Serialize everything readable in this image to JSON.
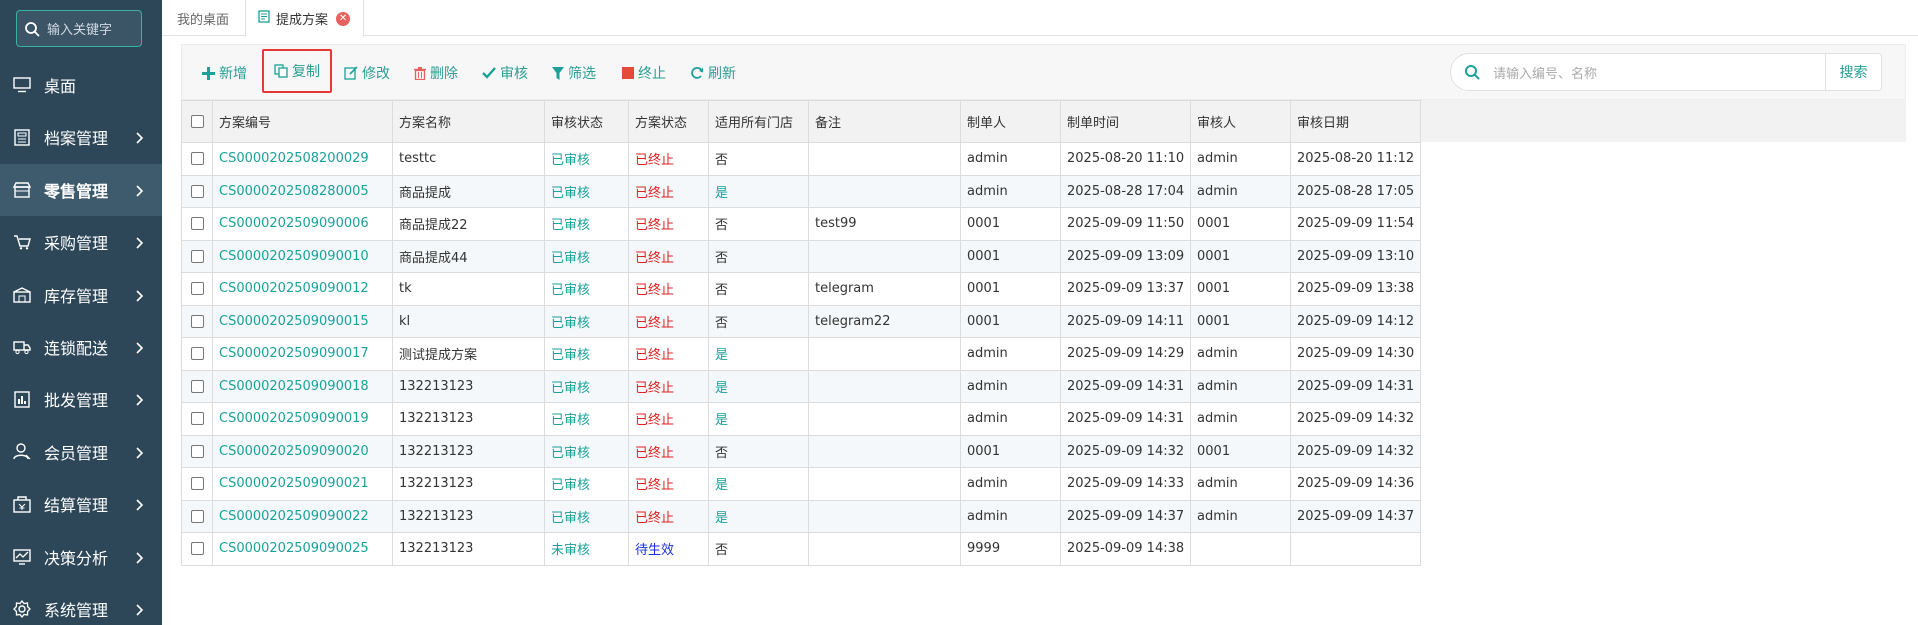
{
  "sidebar": {
    "search_placeholder": "输入关键字",
    "items": [
      {
        "label": "桌面",
        "icon": "desktop-icon",
        "has_children": false,
        "active": false
      },
      {
        "label": "档案管理",
        "icon": "archive-icon",
        "has_children": true,
        "active": false
      },
      {
        "label": "零售管理",
        "icon": "store-icon",
        "has_children": true,
        "active": true
      },
      {
        "label": "采购管理",
        "icon": "purchase-icon",
        "has_children": true,
        "active": false
      },
      {
        "label": "库存管理",
        "icon": "inventory-icon",
        "has_children": true,
        "active": false
      },
      {
        "label": "连锁配送",
        "icon": "truck-icon",
        "has_children": true,
        "active": false
      },
      {
        "label": "批发管理",
        "icon": "wholesale-icon",
        "has_children": true,
        "active": false
      },
      {
        "label": "会员管理",
        "icon": "member-icon",
        "has_children": true,
        "active": false
      },
      {
        "label": "结算管理",
        "icon": "settlement-icon",
        "has_children": true,
        "active": false
      },
      {
        "label": "决策分析",
        "icon": "analysis-icon",
        "has_children": true,
        "active": false
      },
      {
        "label": "系统管理",
        "icon": "gear-icon",
        "has_children": true,
        "active": false
      }
    ]
  },
  "tabs": {
    "home": "我的桌面",
    "current": "提成方案"
  },
  "toolbar": {
    "add": "新增",
    "copy": "复制",
    "edit": "修改",
    "delete": "删除",
    "audit": "审核",
    "filter": "筛选",
    "stop": "终止",
    "refresh": "刷新",
    "search_placeholder": "请输入编号、名称",
    "search_button": "搜索"
  },
  "table": {
    "headers": [
      "方案编号",
      "方案名称",
      "审核状态",
      "方案状态",
      "适用所有门店",
      "备注",
      "制单人",
      "制单时间",
      "审核人",
      "审核日期"
    ],
    "rows": [
      {
        "code": "CS0000202508200029",
        "name": "testtc",
        "audit": "已审核",
        "status": "已终止",
        "all_stores": "否",
        "remark": "",
        "creator": "admin",
        "created": "2025-08-20 11:10",
        "auditor": "admin",
        "audit_date": "2025-08-20 11:12"
      },
      {
        "code": "CS0000202508280005",
        "name": "商品提成",
        "audit": "已审核",
        "status": "已终止",
        "all_stores": "是",
        "remark": "",
        "creator": "admin",
        "created": "2025-08-28 17:04",
        "auditor": "admin",
        "audit_date": "2025-08-28 17:05"
      },
      {
        "code": "CS0000202509090006",
        "name": "商品提成22",
        "audit": "已审核",
        "status": "已终止",
        "all_stores": "否",
        "remark": "test99",
        "creator": "0001",
        "created": "2025-09-09 11:50",
        "auditor": "0001",
        "audit_date": "2025-09-09 11:54"
      },
      {
        "code": "CS0000202509090010",
        "name": "商品提成44",
        "audit": "已审核",
        "status": "已终止",
        "all_stores": "否",
        "remark": "",
        "creator": "0001",
        "created": "2025-09-09 13:09",
        "auditor": "0001",
        "audit_date": "2025-09-09 13:10"
      },
      {
        "code": "CS0000202509090012",
        "name": "tk",
        "audit": "已审核",
        "status": "已终止",
        "all_stores": "否",
        "remark": "telegram",
        "creator": "0001",
        "created": "2025-09-09 13:37",
        "auditor": "0001",
        "audit_date": "2025-09-09 13:38"
      },
      {
        "code": "CS0000202509090015",
        "name": "kl",
        "audit": "已审核",
        "status": "已终止",
        "all_stores": "否",
        "remark": "telegram22",
        "creator": "0001",
        "created": "2025-09-09 14:11",
        "auditor": "0001",
        "audit_date": "2025-09-09 14:12"
      },
      {
        "code": "CS0000202509090017",
        "name": "测试提成方案",
        "audit": "已审核",
        "status": "已终止",
        "all_stores": "是",
        "remark": "",
        "creator": "admin",
        "created": "2025-09-09 14:29",
        "auditor": "admin",
        "audit_date": "2025-09-09 14:30"
      },
      {
        "code": "CS0000202509090018",
        "name": "132213123",
        "audit": "已审核",
        "status": "已终止",
        "all_stores": "是",
        "remark": "",
        "creator": "admin",
        "created": "2025-09-09 14:31",
        "auditor": "admin",
        "audit_date": "2025-09-09 14:31"
      },
      {
        "code": "CS0000202509090019",
        "name": "132213123",
        "audit": "已审核",
        "status": "已终止",
        "all_stores": "是",
        "remark": "",
        "creator": "admin",
        "created": "2025-09-09 14:31",
        "auditor": "admin",
        "audit_date": "2025-09-09 14:32"
      },
      {
        "code": "CS0000202509090020",
        "name": "132213123",
        "audit": "已审核",
        "status": "已终止",
        "all_stores": "否",
        "remark": "",
        "creator": "0001",
        "created": "2025-09-09 14:32",
        "auditor": "0001",
        "audit_date": "2025-09-09 14:32"
      },
      {
        "code": "CS0000202509090021",
        "name": "132213123",
        "audit": "已审核",
        "status": "已终止",
        "all_stores": "是",
        "remark": "",
        "creator": "admin",
        "created": "2025-09-09 14:33",
        "auditor": "admin",
        "audit_date": "2025-09-09 14:36"
      },
      {
        "code": "CS0000202509090022",
        "name": "132213123",
        "audit": "已审核",
        "status": "已终止",
        "all_stores": "是",
        "remark": "",
        "creator": "admin",
        "created": "2025-09-09 14:37",
        "auditor": "admin",
        "audit_date": "2025-09-09 14:37"
      },
      {
        "code": "CS0000202509090025",
        "name": "132213123",
        "audit": "未审核",
        "status": "待生效",
        "all_stores": "否",
        "remark": "",
        "creator": "9999",
        "created": "2025-09-09 14:38",
        "auditor": "",
        "audit_date": ""
      }
    ]
  },
  "colors": {
    "sidebar_bg": "#2d4759",
    "accent": "#1aa199",
    "danger": "#e02020",
    "pending": "#1a2ee0"
  }
}
